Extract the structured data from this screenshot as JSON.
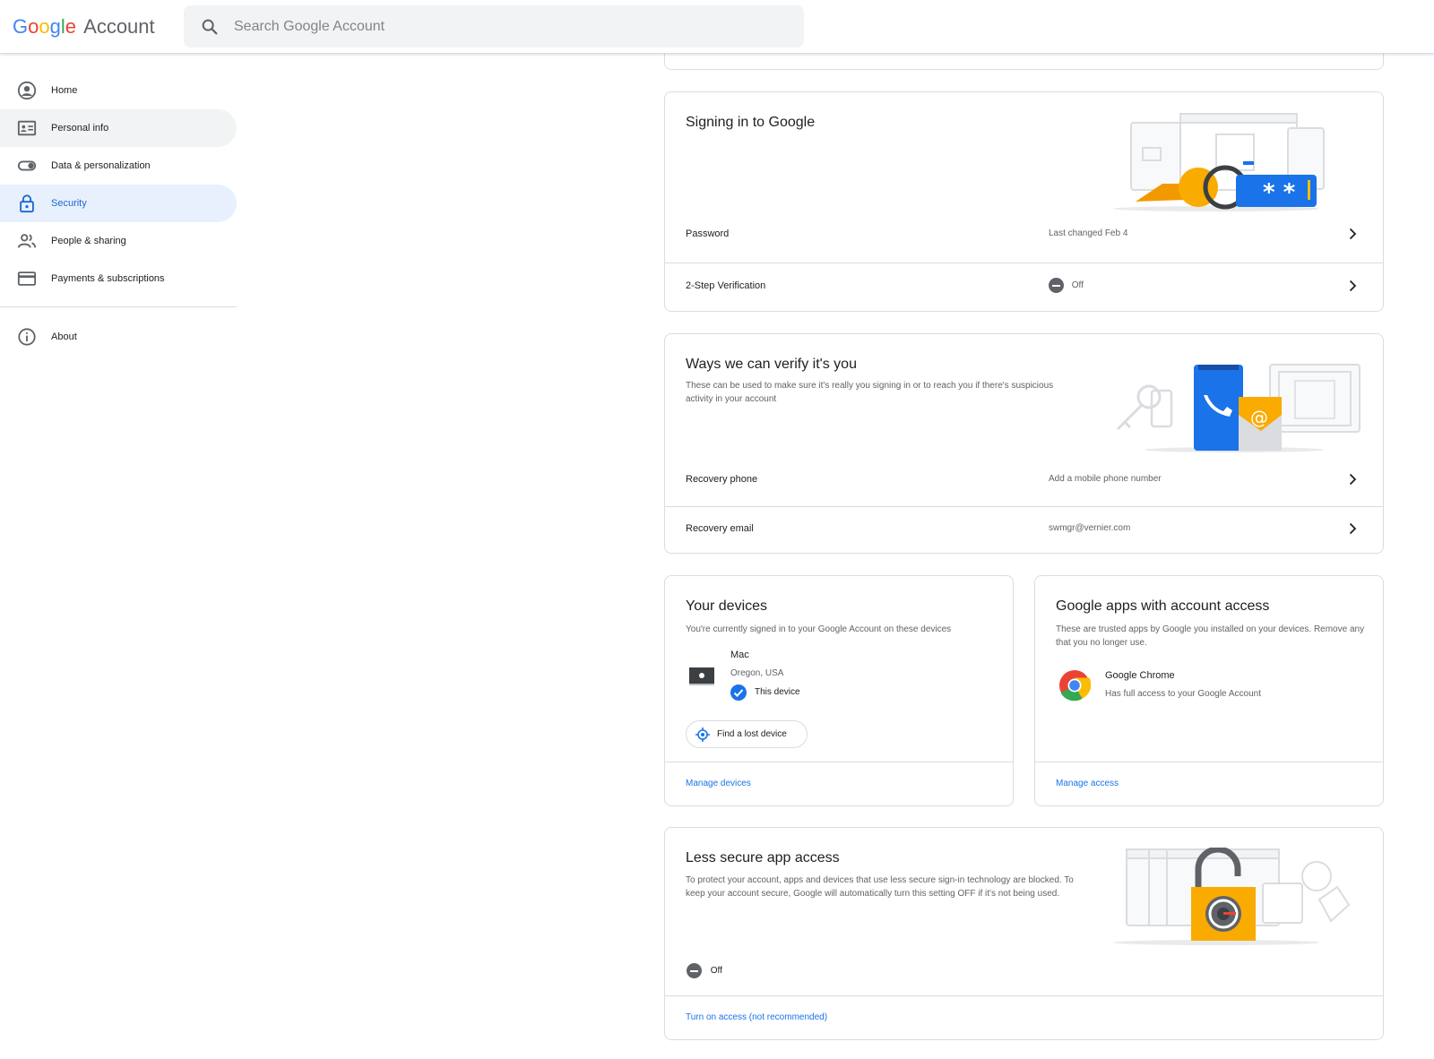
{
  "header": {
    "logo_google": [
      "G",
      "o",
      "o",
      "g",
      "l",
      "e"
    ],
    "logo_account": "Account",
    "search_placeholder": "Search Google Account"
  },
  "sidebar": {
    "items": [
      {
        "label": "Home",
        "icon": "account-circle-icon"
      },
      {
        "label": "Personal info",
        "icon": "id-card-icon"
      },
      {
        "label": "Data & personalization",
        "icon": "toggle-icon"
      },
      {
        "label": "Security",
        "icon": "lock-icon"
      },
      {
        "label": "People & sharing",
        "icon": "people-icon"
      },
      {
        "label": "Payments & subscriptions",
        "icon": "credit-card-icon"
      }
    ],
    "about": {
      "label": "About",
      "icon": "info-icon"
    }
  },
  "signing_in": {
    "title": "Signing in to Google",
    "rows": [
      {
        "label": "Password",
        "value": "Last changed Feb 4"
      },
      {
        "label": "2-Step Verification",
        "value": "Off"
      }
    ]
  },
  "verify": {
    "title": "Ways we can verify it's you",
    "desc": "These can be used to make sure it's really you signing in or to reach you if there's suspicious activity in your account",
    "rows": [
      {
        "label": "Recovery phone",
        "value": "Add a mobile phone number"
      },
      {
        "label": "Recovery email",
        "value": "swmgr@vernier.com"
      }
    ]
  },
  "devices": {
    "title": "Your devices",
    "desc": "You're currently signed in to your Google Account on these devices",
    "device_name": "Mac",
    "device_location": "Oregon, USA",
    "device_badge": "This device",
    "find_button": "Find a lost device",
    "manage_link": "Manage devices"
  },
  "apps": {
    "title": "Google apps with account access",
    "desc": "These are trusted apps by Google you installed on your devices. Remove any that you no longer use.",
    "app_name": "Google Chrome",
    "app_desc": "Has full access to your Google Account",
    "manage_link": "Manage access"
  },
  "less_secure": {
    "title": "Less secure app access",
    "desc": "To protect your account, apps and devices that use less secure sign-in technology are blocked. To keep your account secure, Google will automatically turn this setting OFF if it's not being used.",
    "status": "Off",
    "link": "Turn on access (not recommended)"
  },
  "colors": {
    "accent": "#1a73e8",
    "active_nav_bg": "#e8f0fe",
    "border": "#dadce0"
  }
}
